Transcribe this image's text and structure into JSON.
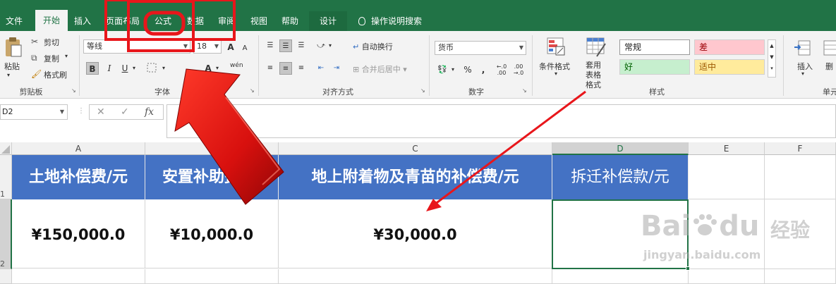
{
  "ribbon_tabs": [
    "文件",
    "开始",
    "插入",
    "页面布局",
    "公式",
    "数据",
    "审阅",
    "视图",
    "帮助",
    "设计"
  ],
  "tell_me": "操作说明搜索",
  "clipboard": {
    "paste": "粘贴",
    "cut": "剪切",
    "copy": "复制",
    "format_painter": "格式刷",
    "label": "剪贴板"
  },
  "font": {
    "name": "等线",
    "size": "18",
    "bold": "B",
    "italic": "I",
    "underline": "U",
    "label": "字体",
    "increase": "A",
    "decrease": "A",
    "pinyin": "wén"
  },
  "alignment": {
    "wrap_text": "自动换行",
    "merge_center": "合并后居中",
    "label": "对齐方式"
  },
  "number": {
    "format": "货币",
    "label": "数字",
    "percent": "%",
    "comma": ","
  },
  "styles": {
    "conditional": "条件格式",
    "table_format": "套用表格格式",
    "normal": "常规",
    "bad": "差",
    "good": "好",
    "neutral": "适中",
    "label": "样式"
  },
  "cells_group": {
    "insert": "插入",
    "delete": "删",
    "label": "单元"
  },
  "name_box": "D2",
  "fx": "fx",
  "columns": [
    "A",
    "B",
    "C",
    "D",
    "E",
    "F"
  ],
  "rows": [
    "1",
    "2"
  ],
  "headers": [
    "土地补偿费/元",
    "安置补助费/元",
    "地上附着物及青苗的补偿费/元",
    "拆迁补偿款/元"
  ],
  "values": [
    "¥150,000.0",
    "¥10,000.0",
    "¥30,000.0",
    ""
  ],
  "watermark": {
    "logo": "Bai",
    "logo2": "du",
    "cn": "经验",
    "url": "jingyan.baidu.com"
  },
  "colors": {
    "excel_green": "#217346",
    "header_blue": "#4472c4",
    "annotation_red": "#e8161b"
  }
}
